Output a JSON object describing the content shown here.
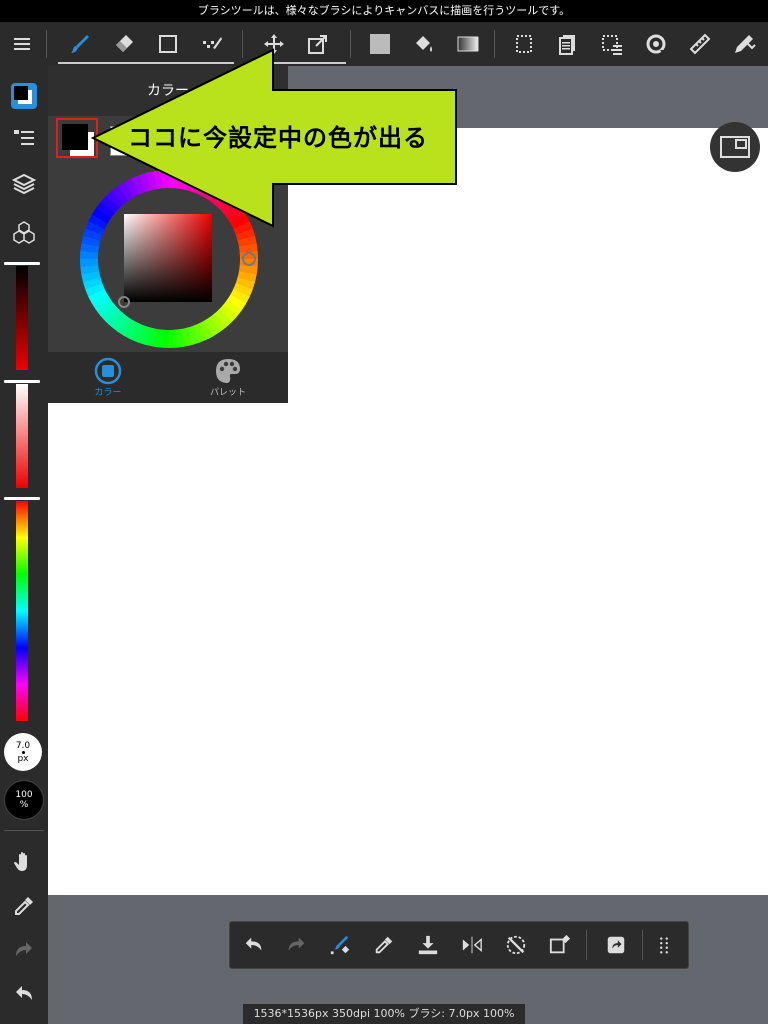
{
  "hint": {
    "text": "ブラシツールは、様々なブラシによりキャンバスに描画を行うツールです。"
  },
  "colors": {
    "accent": "#2a8fd8",
    "callout": "#b9e21c",
    "dark": "#2b2b2b",
    "canvas": "#ffffff"
  },
  "toolbar": {
    "icons": [
      "menu-icon",
      "brush-icon",
      "eraser-icon",
      "shape-icon",
      "dot-icon",
      "move-icon",
      "transform-icon",
      "fill-color-icon",
      "bucket-icon",
      "gradient-icon",
      "select-icon",
      "layer-copy-icon",
      "select-dotted-icon",
      "rotate-icon",
      "ruler-icon",
      "pen-icon"
    ]
  },
  "panel": {
    "title": "カラー",
    "tab_color": "カラー",
    "tab_palette": "パレット"
  },
  "callout": {
    "text": "ココに今設定中の色が出る"
  },
  "sidebar": {
    "brush_size_value": "7.0",
    "brush_size_unit": "px",
    "opacity_value": "100",
    "opacity_unit": "%"
  },
  "status": {
    "text": "1536*1536px 350dpi 100% ブラシ: 7.0px 100%"
  }
}
